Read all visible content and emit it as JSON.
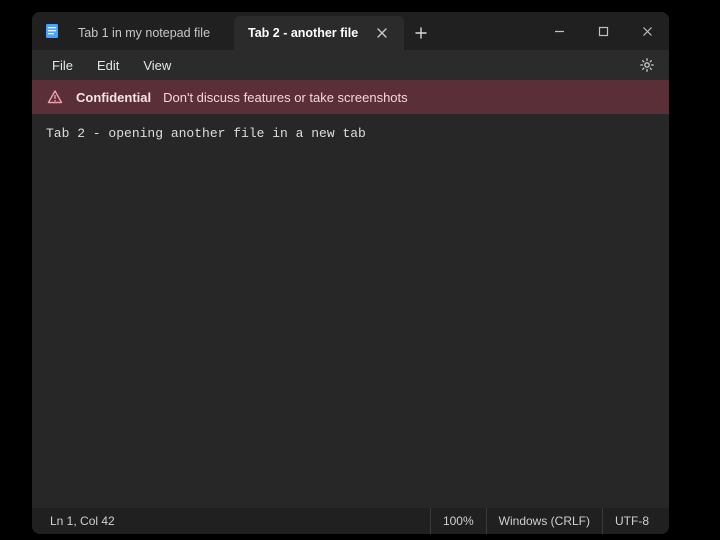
{
  "tabs": {
    "items": [
      {
        "label": "Tab 1 in my notepad file"
      },
      {
        "label": "Tab 2 - another file"
      }
    ],
    "active_index": 1
  },
  "menubar": {
    "file": "File",
    "edit": "Edit",
    "view": "View"
  },
  "banner": {
    "strong": "Confidential",
    "text": "Don't discuss features or take screenshots"
  },
  "editor": {
    "content": "Tab 2 - opening another file in a new tab"
  },
  "statusbar": {
    "position": "Ln 1, Col 42",
    "zoom": "100%",
    "line_endings": "Windows (CRLF)",
    "encoding": "UTF-8"
  }
}
